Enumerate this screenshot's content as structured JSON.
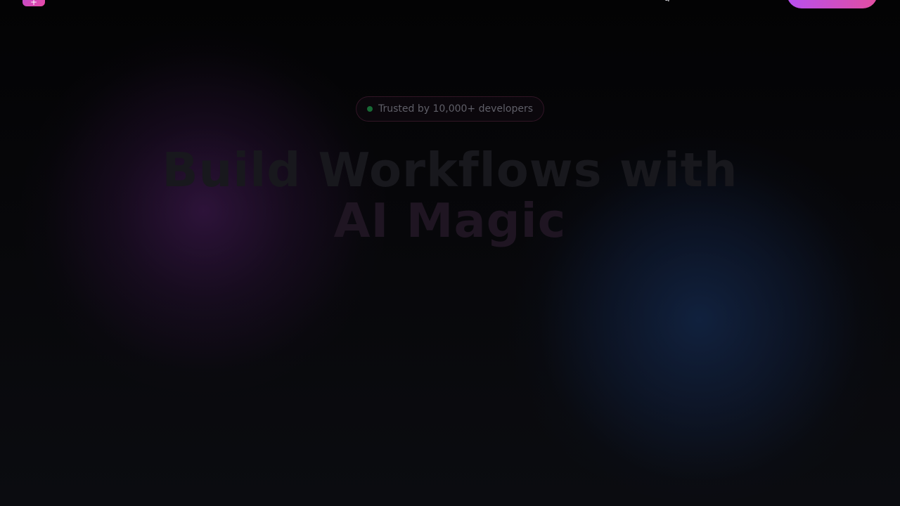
{
  "nav": {
    "logo_symbol": "+",
    "link_fragment": "g",
    "cta_label": ""
  },
  "badge": {
    "text": "Trusted by 10,000+ developers",
    "dot_color": "#1b7a3d"
  },
  "hero": {
    "title_line1": "Build Workflows with",
    "title_line2": "AI Magic"
  },
  "colors": {
    "accent_start": "#b84ff0",
    "accent_end": "#e24ea0",
    "glow_purple": "#441a56",
    "glow_blue": "#16305c",
    "background": "#050507"
  }
}
